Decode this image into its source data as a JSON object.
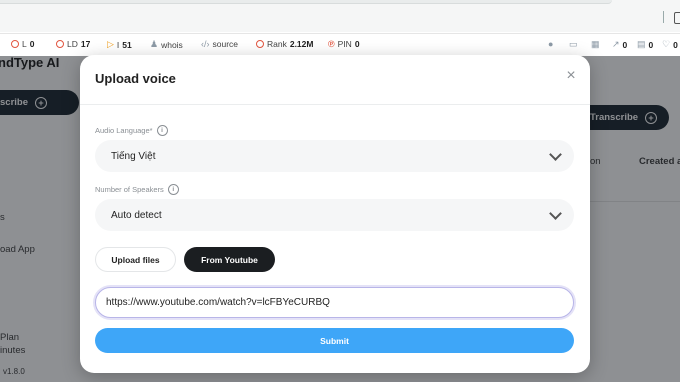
{
  "seo_toolbar": {
    "items": [
      {
        "label": "L",
        "value": "0"
      },
      {
        "label": "LD",
        "value": "17"
      },
      {
        "label": "I",
        "value": "51"
      },
      {
        "label": "whois",
        "value": ""
      },
      {
        "label": "source",
        "value": ""
      },
      {
        "label": "Rank",
        "value": "2.12M"
      },
      {
        "label": "PIN",
        "value": "0"
      }
    ],
    "right_counts": [
      "0",
      "0",
      "0"
    ]
  },
  "background_app": {
    "title_fragment": "ndType AI",
    "transcribe_left": "scribe",
    "transcribe_right": "Transcribe",
    "col_on": "on",
    "col_created": "Created at",
    "nav_s": "s",
    "nav_load_app": "oad App",
    "plan": "Plan",
    "minutes": "inutes",
    "version": "v1.8.0"
  },
  "modal": {
    "title": "Upload voice",
    "close_symbol": "×",
    "audio_language_label": "Audio Language*",
    "audio_language_value": "Tiếng Việt",
    "speakers_label": "Number of Speakers",
    "speakers_value": "Auto detect",
    "tab_upload": "Upload files",
    "tab_youtube": "From Youtube",
    "url_value": "https://www.youtube.com/watch?v=lcFBYeCURBQ",
    "submit_label": "Submit",
    "info_symbol": "i"
  },
  "colors": {
    "submit": "#3ea6f8",
    "active_tab": "#1b1e21",
    "input_focus": "#b8b5e8"
  }
}
